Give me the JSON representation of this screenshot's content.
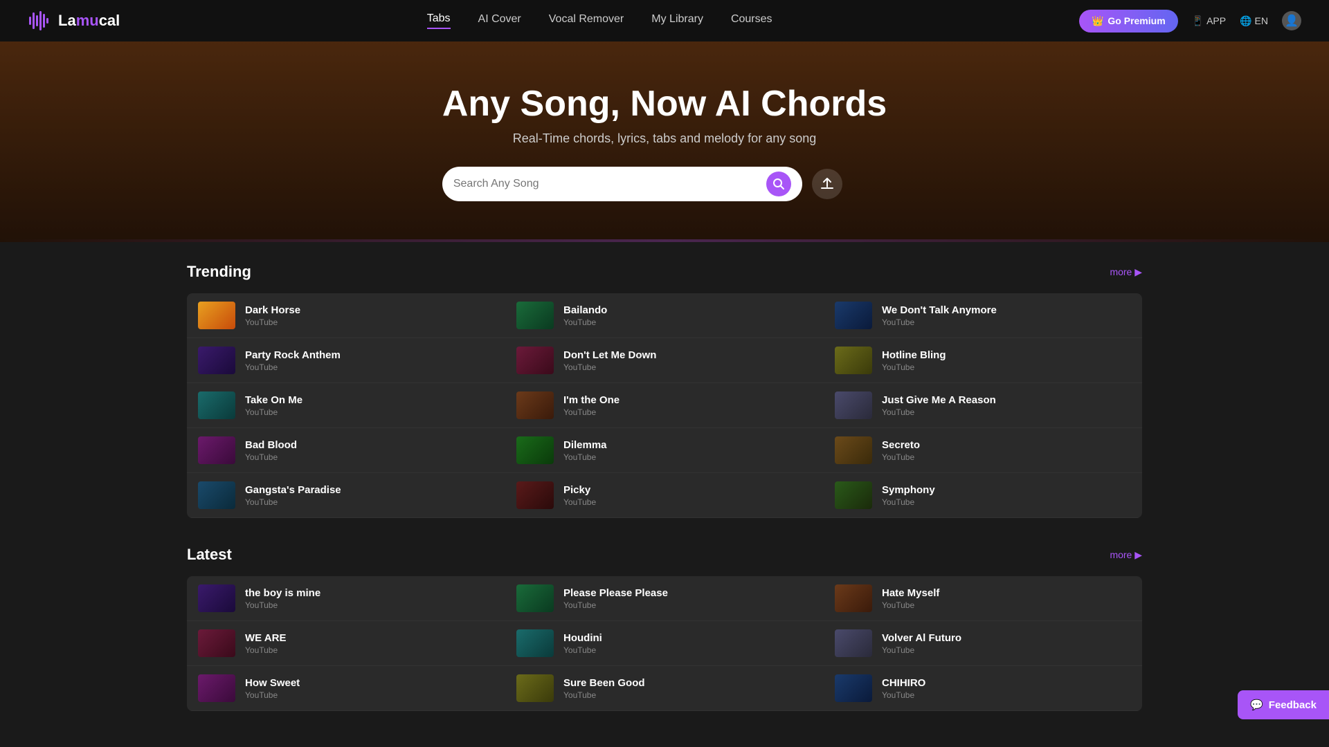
{
  "brand": {
    "name_start": "La",
    "name_highlight": "mu",
    "name_end": "cal"
  },
  "nav": {
    "tabs_label": "Tabs",
    "ai_cover_label": "AI Cover",
    "vocal_remover_label": "Vocal Remover",
    "my_library_label": "My Library",
    "courses_label": "Courses",
    "premium_label": "Go Premium",
    "app_label": "APP",
    "lang_label": "EN"
  },
  "hero": {
    "title": "Any Song, Now AI Chords",
    "subtitle": "Real-Time chords, lyrics, tabs and melody for any song",
    "search_placeholder": "Search Any Song"
  },
  "trending": {
    "section_label": "Trending",
    "more_label": "more ▶",
    "songs": [
      {
        "name": "Dark Horse",
        "source": "YouTube",
        "color": "thumb-color-1"
      },
      {
        "name": "Bailando",
        "source": "YouTube",
        "color": "thumb-color-2"
      },
      {
        "name": "We Don't Talk Anymore",
        "source": "YouTube",
        "color": "thumb-color-3"
      },
      {
        "name": "Party Rock Anthem",
        "source": "YouTube",
        "color": "thumb-color-4"
      },
      {
        "name": "Don't Let Me Down",
        "source": "YouTube",
        "color": "thumb-color-5"
      },
      {
        "name": "Hotline Bling",
        "source": "YouTube",
        "color": "thumb-color-6"
      },
      {
        "name": "Take On Me",
        "source": "YouTube",
        "color": "thumb-color-7"
      },
      {
        "name": "I'm the One",
        "source": "YouTube",
        "color": "thumb-color-8"
      },
      {
        "name": "Just Give Me A Reason",
        "source": "YouTube",
        "color": "thumb-color-9"
      },
      {
        "name": "Bad Blood",
        "source": "YouTube",
        "color": "thumb-color-10"
      },
      {
        "name": "Dilemma",
        "source": "YouTube",
        "color": "thumb-color-11"
      },
      {
        "name": "Secreto",
        "source": "YouTube",
        "color": "thumb-color-12"
      },
      {
        "name": "Gangsta's Paradise",
        "source": "YouTube",
        "color": "thumb-color-13"
      },
      {
        "name": "Picky",
        "source": "YouTube",
        "color": "thumb-color-14"
      },
      {
        "name": "Symphony",
        "source": "YouTube",
        "color": "thumb-color-15"
      }
    ]
  },
  "latest": {
    "section_label": "Latest",
    "more_label": "more ▶",
    "songs": [
      {
        "name": "the boy is mine",
        "source": "YouTube",
        "color": "thumb-color-4"
      },
      {
        "name": "Please Please Please",
        "source": "YouTube",
        "color": "thumb-color-2"
      },
      {
        "name": "Hate Myself",
        "source": "YouTube",
        "color": "thumb-color-8"
      },
      {
        "name": "WE ARE",
        "source": "YouTube",
        "color": "thumb-color-5"
      },
      {
        "name": "Houdini",
        "source": "YouTube",
        "color": "thumb-color-7"
      },
      {
        "name": "Volver Al Futuro",
        "source": "YouTube",
        "color": "thumb-color-9"
      },
      {
        "name": "How Sweet",
        "source": "YouTube",
        "color": "thumb-color-10"
      },
      {
        "name": "Sure Been Good",
        "source": "YouTube",
        "color": "thumb-color-6"
      },
      {
        "name": "CHIHIRO",
        "source": "YouTube",
        "color": "thumb-color-3"
      }
    ]
  },
  "feedback": {
    "label": "Feedback"
  }
}
